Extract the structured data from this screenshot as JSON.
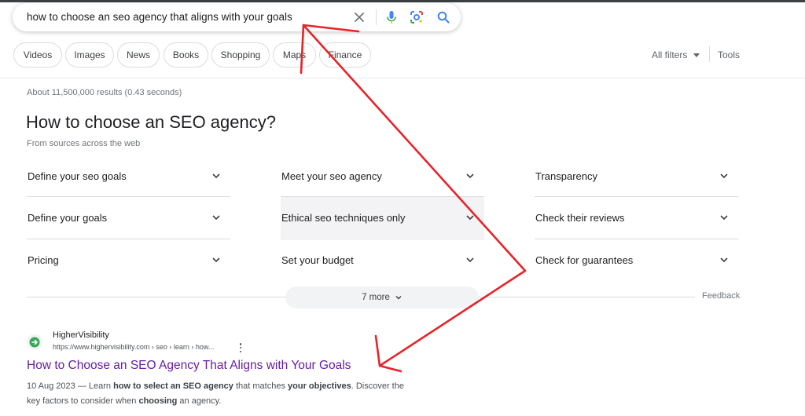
{
  "search": {
    "query": "how to choose an seo agency that aligns with your goals",
    "clear_icon": "close-icon",
    "voice_icon": "mic-icon",
    "lens_icon": "camera-lens-icon",
    "search_icon": "search-icon"
  },
  "filters": {
    "chips": [
      "Videos",
      "Images",
      "News",
      "Books",
      "Shopping",
      "Maps",
      "Finance"
    ],
    "all_filters": "All filters",
    "tools": "Tools"
  },
  "results_stats": "About 11,500,000 results (0.43 seconds)",
  "faq": {
    "title": "How to choose an SEO agency?",
    "subtitle": "From sources across the web",
    "items": [
      "Define your seo goals",
      "Meet your seo agency",
      "Transparency",
      "Define your goals",
      "Ethical seo techniques only",
      "Check their reviews",
      "Pricing",
      "Set your budget",
      "Check for guarantees"
    ],
    "more_label": "7 more",
    "feedback": "Feedback"
  },
  "result": {
    "site_name": "HigherVisibility",
    "url": "https://www.highervisibility.com › seo › learn › how...",
    "title": "How to Choose an SEO Agency That Aligns with Your Goals",
    "snippet_parts": [
      "10 Aug 2023 — Learn ",
      "how to select an SEO agency",
      " that matches ",
      "your objectives",
      ". Discover the key factors to consider when ",
      "choosing",
      " an agency."
    ]
  },
  "colors": {
    "link_visited": "#681da8",
    "annotation": "#e8232a",
    "mic_blue": "#4285f4",
    "mic_red": "#ea4335"
  }
}
